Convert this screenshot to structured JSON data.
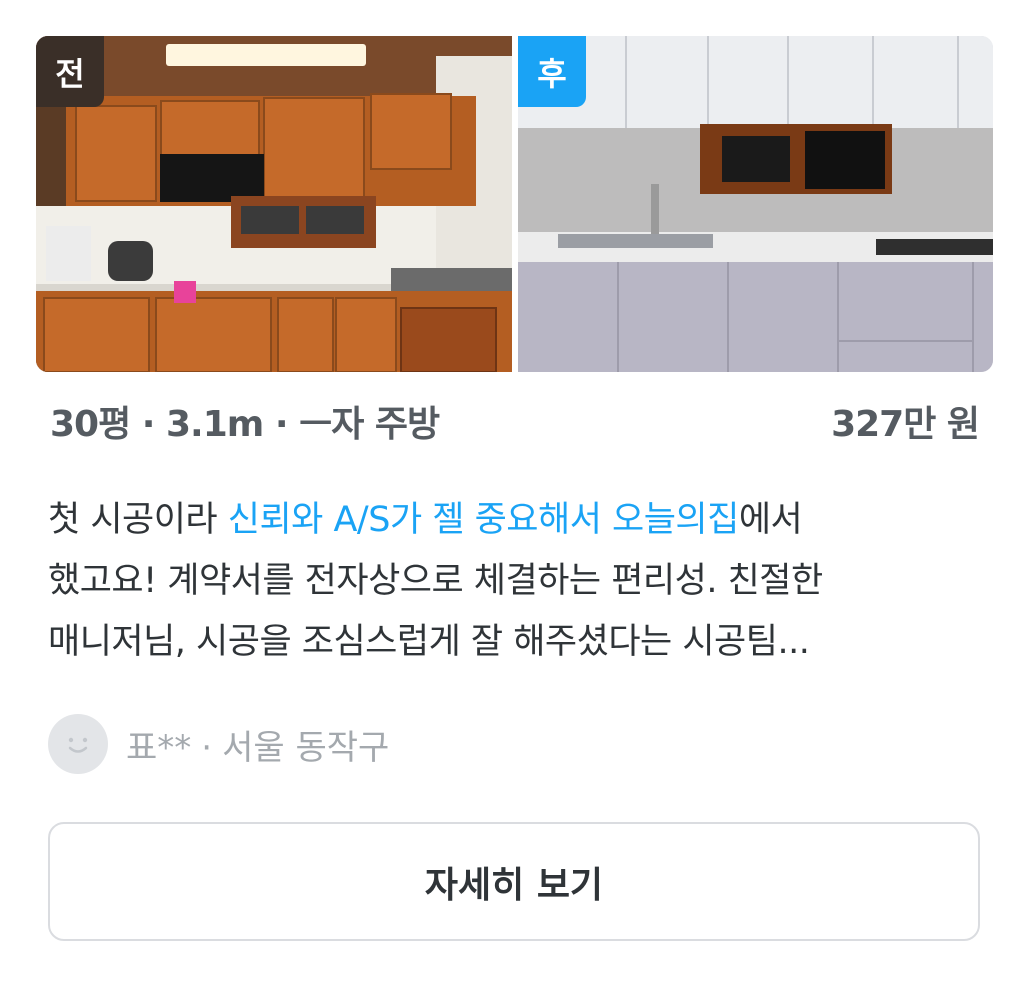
{
  "photos": {
    "before_label": "전",
    "after_label": "후"
  },
  "summary": {
    "size": "30평",
    "length": "3.1m",
    "layout": "ㅡ자 주방",
    "sep": "·",
    "price": "327만 원"
  },
  "review": {
    "lines": [
      [
        {
          "text": "첫 시공이라 ",
          "highlight": false
        },
        {
          "text": "신뢰와 A/S가 젤 중요해서 오늘의집",
          "highlight": true
        },
        {
          "text": "에서",
          "highlight": false
        }
      ],
      [
        {
          "text": "했고요! 계약서를 전자상으로 체결하는 편리성. 친절한",
          "highlight": false
        }
      ],
      [
        {
          "text": "매니저님, 시공을 조심스럽게 잘 해주셨다는 시공팀...",
          "highlight": false
        }
      ]
    ],
    "highlight_color": "#1aa3f5"
  },
  "author": {
    "name": "표**",
    "sep": "·",
    "location": "서울 동작구",
    "avatar_icon": "smiley-face-icon"
  },
  "actions": {
    "detail_label": "자세히 보기"
  },
  "colors": {
    "accent": "#1aa3f5",
    "before_tag": "#3a2f28",
    "text": "#2f3438",
    "muted": "#a4a9ae"
  }
}
